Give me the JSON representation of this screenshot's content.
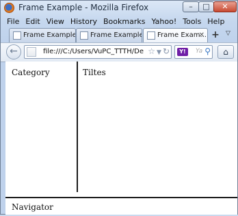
{
  "window": {
    "title": "Frame Example - Mozilla Firefox"
  },
  "menubar": {
    "items": [
      "File",
      "Edit",
      "View",
      "History",
      "Bookmarks",
      "Yahoo!",
      "Tools",
      "Help"
    ]
  },
  "tabs": [
    {
      "label": "Frame Example",
      "active": false
    },
    {
      "label": "Frame Example",
      "active": false
    },
    {
      "label": "Frame Exam...",
      "active": true
    }
  ],
  "toolbar": {
    "url": "file:///C:/Users/VuPC_TTTH/De",
    "search_placeholder": "Ya",
    "search_engine": "Y!"
  },
  "frames": {
    "category": "Category",
    "titles": "Tiltes",
    "navigator": "Navigator"
  }
}
